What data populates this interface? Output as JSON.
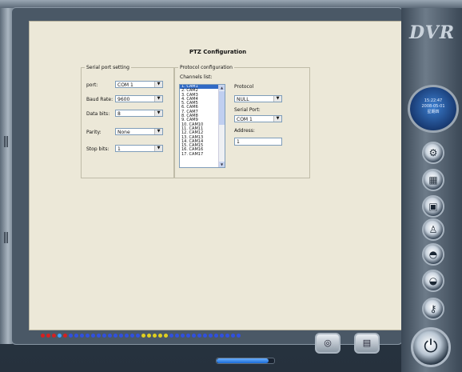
{
  "brand": {
    "label": "DVR"
  },
  "clock": {
    "time": "15:22:47",
    "date": "2008-05-01",
    "weekday": "星期四"
  },
  "page": {
    "title": "PTZ Configuration"
  },
  "serial": {
    "legend": "Serial port setting",
    "port_label": "port:",
    "port_value": "COM 1",
    "baud_label": "Baud Rate:",
    "baud_value": "9600",
    "data_label": "Data bits:",
    "data_value": "8",
    "parity_label": "Parity:",
    "parity_value": "None",
    "stop_label": "Stop bits:",
    "stop_value": "1"
  },
  "protocol": {
    "legend": "Protocol configuration",
    "channels_label": "Channels list:",
    "channels": [
      "1. CAM1",
      "2. CAM2",
      "3. CAM3",
      "4. CAM4",
      "5. CAM5",
      "6. CAM6",
      "7. CAM7",
      "8. CAM8",
      "9. CAM9",
      "10. CAM10",
      "11. CAM11",
      "12. CAM12",
      "13. CAM13",
      "14. CAM14",
      "15. CAM15",
      "16. CAM16",
      "17. CAM17"
    ],
    "selected_channel": "1. CAM1",
    "protocol_label": "Protocol",
    "protocol_value": "NULL",
    "serialport_label": "Serial Port:",
    "serialport_value": "COM 1",
    "address_label": "Address:",
    "address_value": "1"
  },
  "progress": {
    "value_percent": 90
  },
  "icons": [
    "gear-icon",
    "calendar-icon",
    "monitor-icon",
    "person-icon",
    "alarm-icon",
    "disk-icon",
    "key-icon",
    "power-icon",
    "camera-icon",
    "playback-icon"
  ],
  "colors": {
    "accent": "#316ac5",
    "background": "#ece8d8"
  },
  "status_dots": [
    "#d62020",
    "#d62020",
    "#d62020",
    "#3aa0ff",
    "#d62020",
    "#3050e0",
    "#3050e0",
    "#3050e0",
    "#3050e0",
    "#3050e0",
    "#3050e0",
    "#3050e0",
    "#3050e0",
    "#3050e0",
    "#3050e0",
    "#3050e0",
    "#3050e0",
    "#3050e0",
    "#e0d020",
    "#e0d020",
    "#e0d020",
    "#e0d020",
    "#e0d020",
    "#3050e0",
    "#3050e0",
    "#3050e0",
    "#3050e0",
    "#3050e0",
    "#3050e0",
    "#3050e0",
    "#3050e0",
    "#3050e0",
    "#3050e0",
    "#3050e0",
    "#3050e0",
    "#3050e0"
  ]
}
